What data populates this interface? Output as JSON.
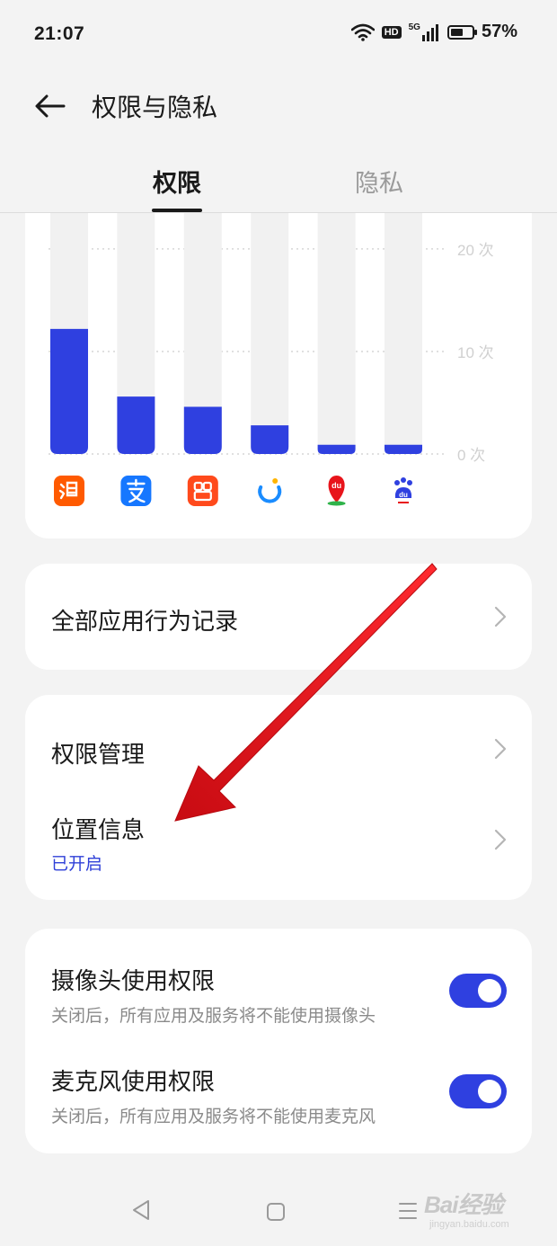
{
  "status_bar": {
    "time": "21:07",
    "hd": "HD",
    "network": "5G",
    "battery_percent": "57%",
    "battery_level": 0.57,
    "icons": [
      "wifi-icon",
      "hd-badge",
      "signal-5g-icon",
      "battery-icon"
    ]
  },
  "header": {
    "back_icon": "arrow-left-icon",
    "title": "权限与隐私"
  },
  "tabs": [
    {
      "label": "权限",
      "active": true
    },
    {
      "label": "隐私",
      "active": false
    }
  ],
  "colors": {
    "accent": "#2f40e0",
    "bar_track": "#f1f1f1",
    "annotation_arrow": "#e8141b"
  },
  "chart_data": {
    "type": "bar",
    "categories": [
      "淘宝",
      "支付宝",
      "快手",
      "饿了么",
      "百度地图",
      "百度"
    ],
    "category_icons": [
      "taobao-app-icon",
      "alipay-app-icon",
      "kuaishou-app-icon",
      "eleme-app-icon",
      "baidu-map-app-icon",
      "baidu-app-icon"
    ],
    "icon_colors": [
      "#ff5a00",
      "#1677ff",
      "#ff4a1c",
      "#1a8cff",
      "#e8141b",
      "#2f40e0"
    ],
    "values": [
      12.2,
      5.6,
      4.6,
      2.8,
      0.9,
      0.9
    ],
    "y_ticks": [
      {
        "value": 0,
        "label": "0 次"
      },
      {
        "value": 10,
        "label": "10 次"
      },
      {
        "value": 20,
        "label": "20 次"
      }
    ],
    "ylim": [
      0,
      23.5
    ],
    "grid": true,
    "bar_color": "#2f40e0"
  },
  "rows": {
    "all_records": {
      "title": "全部应用行为记录",
      "icon": "chevron-right-icon"
    },
    "permission_management": {
      "title": "权限管理",
      "icon": "chevron-right-icon"
    },
    "location": {
      "title": "位置信息",
      "status": "已开启",
      "icon": "chevron-right-icon"
    }
  },
  "toggles": [
    {
      "title": "摄像头使用权限",
      "description": "关闭后，所有应用及服务将不能使用摄像头",
      "on": true
    },
    {
      "title": "麦克风使用权限",
      "description": "关闭后，所有应用及服务将不能使用麦克风",
      "on": true
    }
  ],
  "nav_bar": {
    "icons": [
      "nav-back-icon",
      "nav-home-icon",
      "nav-menu-icon"
    ]
  },
  "watermark": {
    "text": "Bai经验",
    "sub": "jingyan.baidu.com"
  }
}
